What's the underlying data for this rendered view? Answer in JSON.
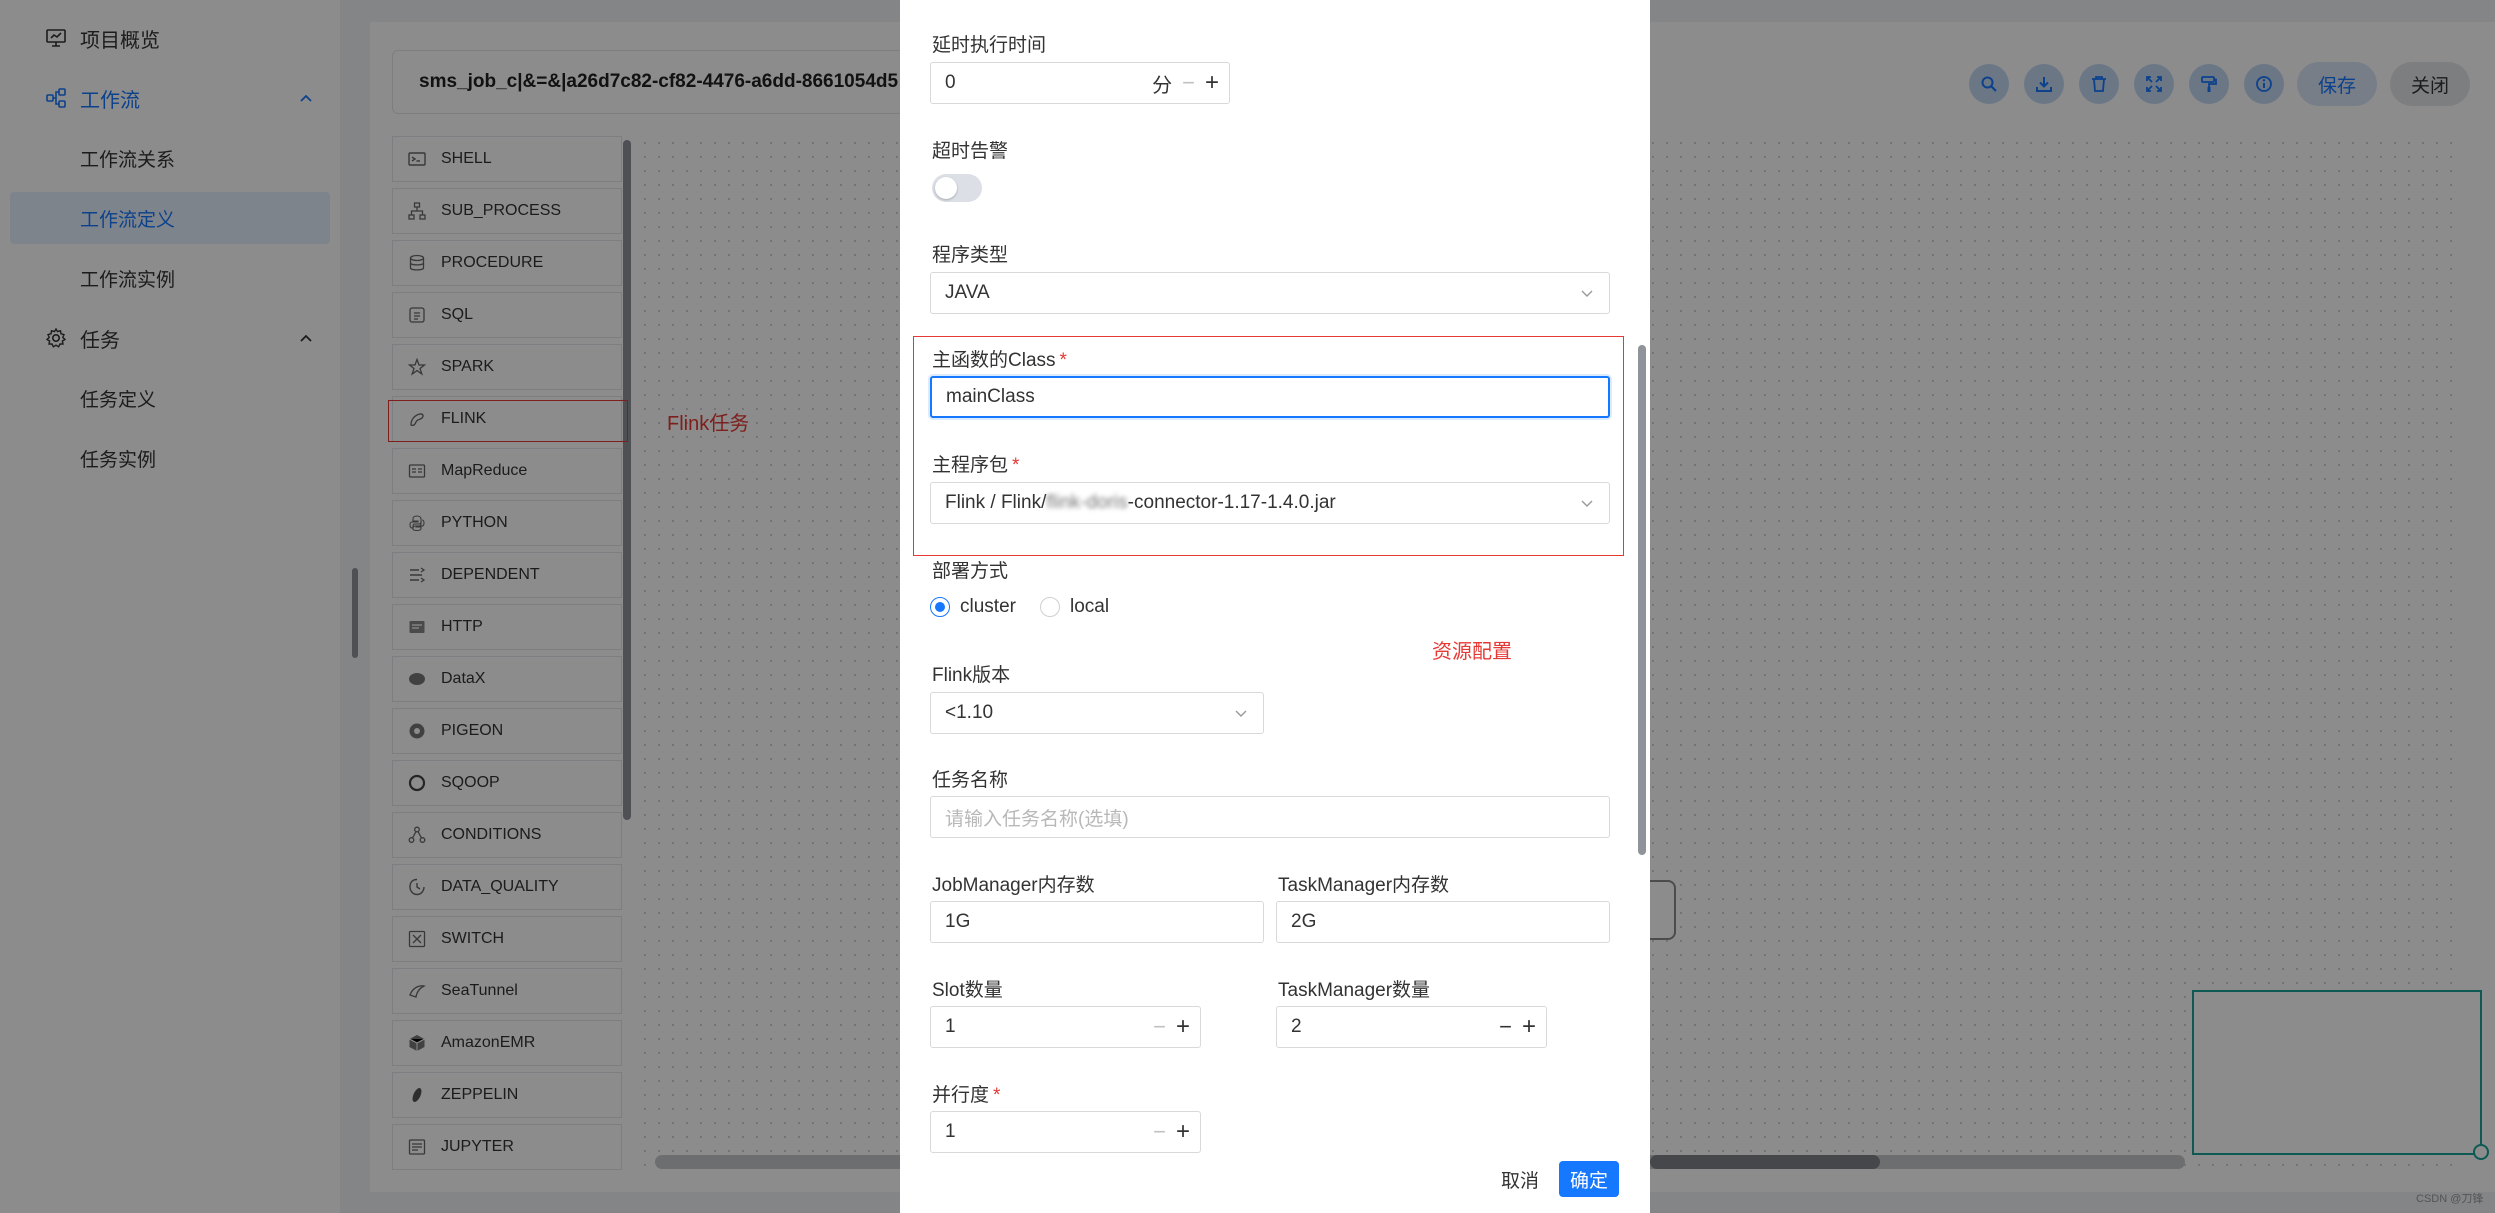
{
  "sidebar": {
    "items": [
      {
        "label": "项目概览"
      },
      {
        "label": "工作流"
      },
      {
        "label": "工作流关系"
      },
      {
        "label": "工作流定义"
      },
      {
        "label": "工作流实例"
      },
      {
        "label": "任务"
      },
      {
        "label": "任务定义"
      },
      {
        "label": "任务实例"
      }
    ]
  },
  "header": {
    "workflow_name": "sms_job_c|&=&|a26d7c82-cf82-4476-a6dd-8661054d5",
    "save_label": "保存",
    "close_label": "关闭",
    "toolbar_icons": [
      "search-icon",
      "download-icon",
      "delete-icon",
      "fullscreen-icon",
      "format-icon",
      "info-icon"
    ]
  },
  "task_panel": {
    "items": [
      {
        "label": "SHELL"
      },
      {
        "label": "SUB_PROCESS"
      },
      {
        "label": "PROCEDURE"
      },
      {
        "label": "SQL"
      },
      {
        "label": "SPARK"
      },
      {
        "label": "FLINK"
      },
      {
        "label": "MapReduce"
      },
      {
        "label": "PYTHON"
      },
      {
        "label": "DEPENDENT"
      },
      {
        "label": "HTTP"
      },
      {
        "label": "DataX"
      },
      {
        "label": "PIGEON"
      },
      {
        "label": "SQOOP"
      },
      {
        "label": "CONDITIONS"
      },
      {
        "label": "DATA_QUALITY"
      },
      {
        "label": "SWITCH"
      },
      {
        "label": "SeaTunnel"
      },
      {
        "label": "AmazonEMR"
      },
      {
        "label": "ZEPPELIN"
      },
      {
        "label": "JUPYTER"
      }
    ],
    "flink_note": "Flink任务"
  },
  "dialog": {
    "delay_label": "延时执行时间",
    "delay_value": "0",
    "delay_unit": "分",
    "timeout_label": "超时告警",
    "timeout_on": false,
    "program_type_label": "程序类型",
    "program_type_value": "JAVA",
    "main_class_label": "主函数的Class",
    "main_class_value": "mainClass",
    "main_jar_label": "主程序包",
    "main_jar_prefix": "Flink / Flink/",
    "main_jar_blurred": "flink-doris",
    "main_jar_suffix": "-connector-1.17-1.4.0.jar",
    "deploy_label": "部署方式",
    "deploy_options": [
      "cluster",
      "local"
    ],
    "deploy_selected": "cluster",
    "resource_note": "资源配置",
    "flink_version_label": "Flink版本",
    "flink_version_value": "<1.10",
    "task_name_label": "任务名称",
    "task_name_placeholder": "请输入任务名称(选填)",
    "jm_memory_label": "JobManager内存数",
    "jm_memory_value": "1G",
    "tm_memory_label": "TaskManager内存数",
    "tm_memory_value": "2G",
    "slot_label": "Slot数量",
    "slot_value": "1",
    "tm_count_label": "TaskManager数量",
    "tm_count_value": "2",
    "parallelism_label": "并行度",
    "parallelism_value": "1",
    "cancel_label": "取消",
    "ok_label": "确定"
  },
  "watermark": "CSDN @刀锋",
  "colors": {
    "primary": "#1677ff",
    "annotation_red": "#e53935",
    "minimap_teal": "#1aa39a"
  }
}
